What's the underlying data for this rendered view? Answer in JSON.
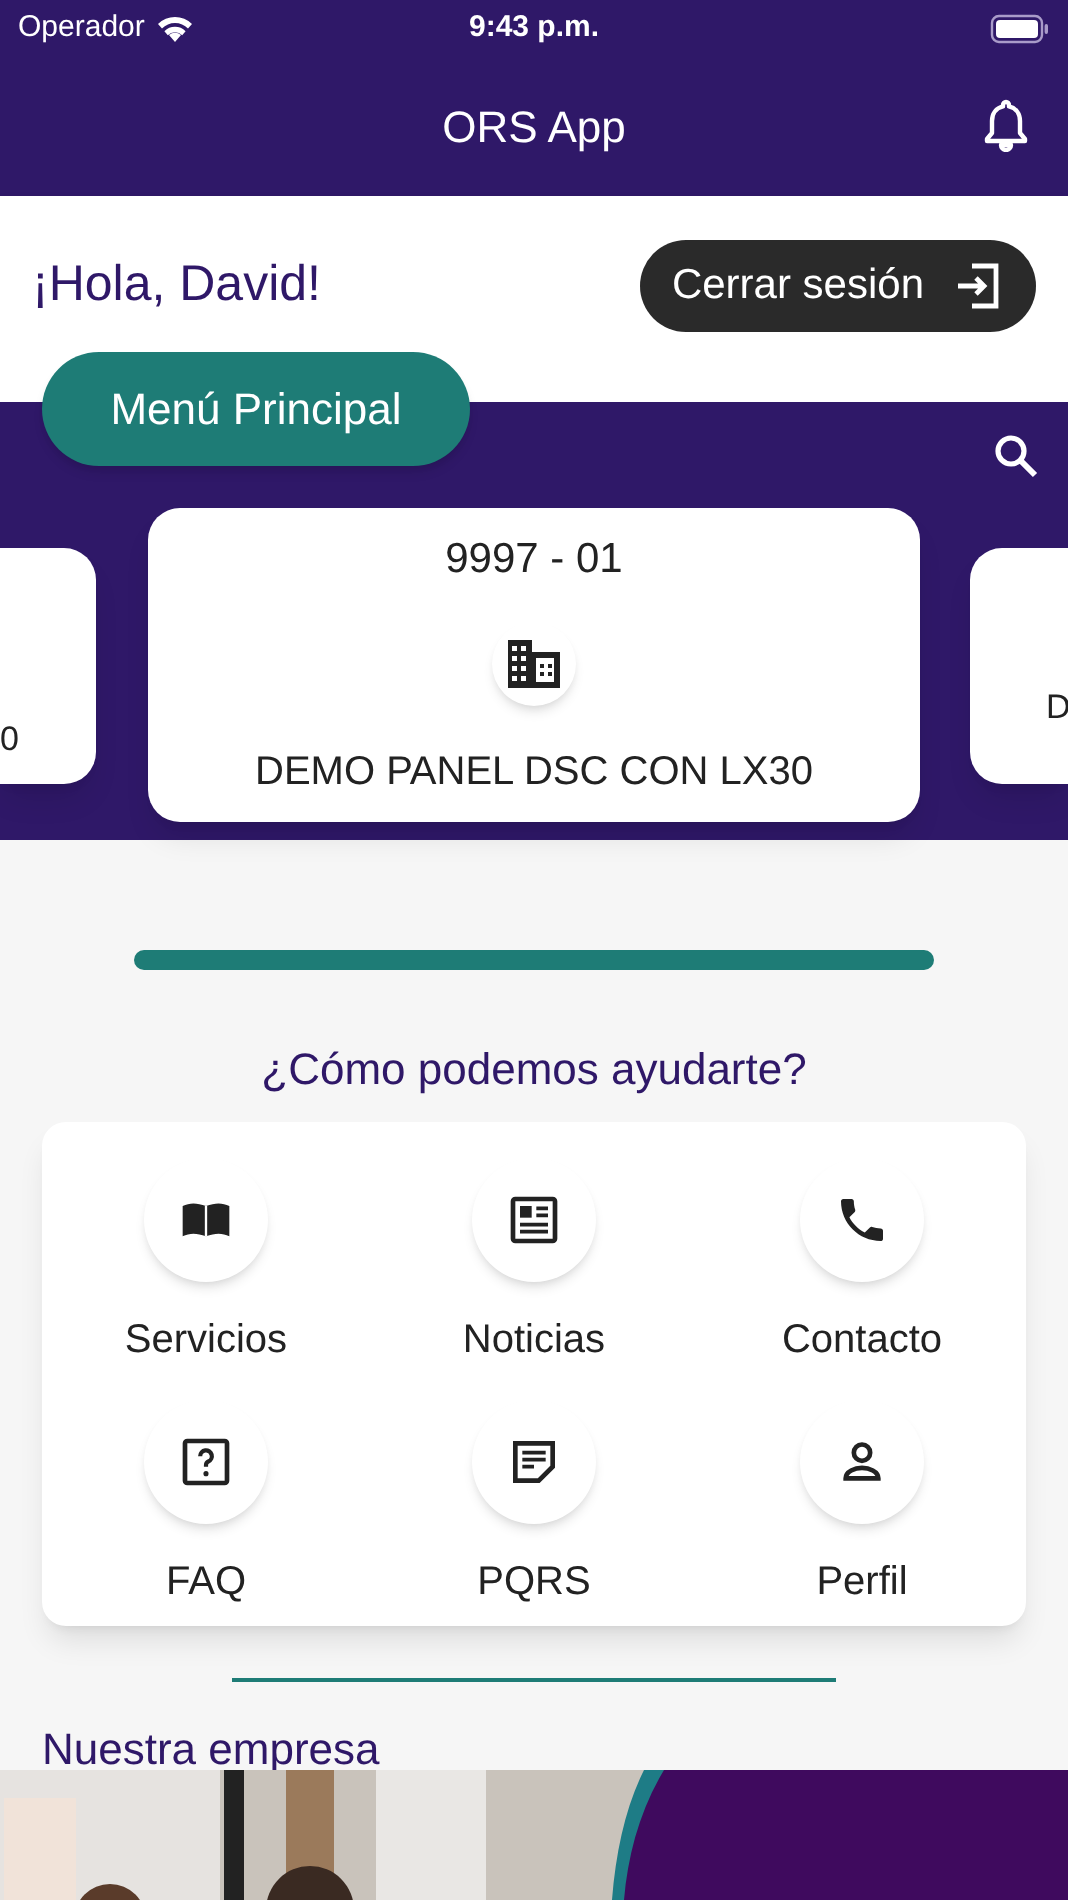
{
  "status_bar": {
    "carrier": "Operador",
    "time": "9:43 p.m."
  },
  "app_bar": {
    "title": "ORS App"
  },
  "greeting": "¡Hola, David!",
  "logout_button": "Cerrar sesión",
  "main_menu_button": "Menú Principal",
  "carousel": [
    {
      "name": "0",
      "kind": "partial_left"
    },
    {
      "code": "9997 - 01",
      "name": "DEMO PANEL DSC CON LX30",
      "kind": "full"
    },
    {
      "name": "D",
      "kind": "partial_right"
    }
  ],
  "help_heading": "¿Cómo podemos ayudarte?",
  "services": [
    {
      "label": "Servicios",
      "kind": "book"
    },
    {
      "label": "Noticias",
      "kind": "news"
    },
    {
      "label": "Contacto",
      "kind": "phone"
    },
    {
      "label": "FAQ",
      "kind": "faq"
    },
    {
      "label": "PQRS",
      "kind": "note"
    },
    {
      "label": "Perfil",
      "kind": "person"
    }
  ],
  "company_heading": "Nuestra empresa"
}
